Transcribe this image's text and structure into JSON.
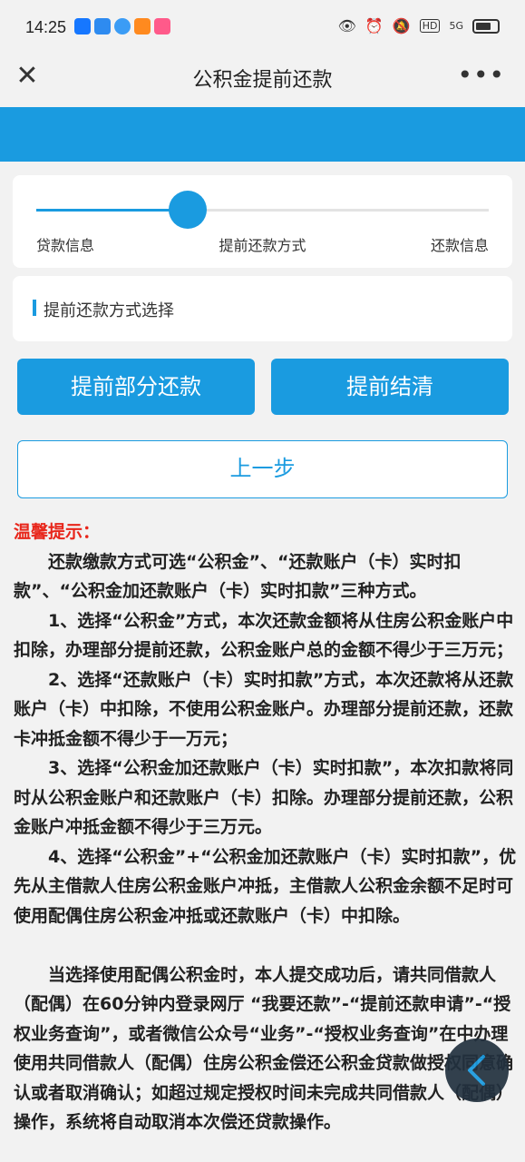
{
  "status_bar": {
    "time": "14:25",
    "signal_text": "5G",
    "hd_text": "HD"
  },
  "nav": {
    "title": "公积金提前还款"
  },
  "steps": {
    "items": [
      "贷款信息",
      "提前还款方式",
      "还款信息"
    ],
    "current_index": 1
  },
  "section": {
    "title": "提前还款方式选择"
  },
  "buttons": {
    "partial": "提前部分还款",
    "full": "提前结清",
    "prev": "上一步"
  },
  "tips": {
    "title": "温馨提示：",
    "paragraphs": [
      "还款缴款方式可选“公积金”、“还款账户（卡）实时扣款”、“公积金加还款账户（卡）实时扣款”三种方式。",
      "1、选择“公积金”方式，本次还款金额将从住房公积金账户中扣除，办理部分提前还款，公积金账户总的金额不得少于三万元；",
      "2、选择“还款账户（卡）实时扣款”方式，本次还款将从还款账户（卡）中扣除，不使用公积金账户。办理部分提前还款，还款卡冲抵金额不得少于一万元；",
      "3、选择“公积金加还款账户（卡）实时扣款”，本次扣款将同时从公积金账户和还款账户（卡）扣除。办理部分提前还款，公积金账户冲抵金额不得少于三万元。",
      "4、选择“公积金”+“公积金加还款账户（卡）实时扣款”，优先从主借款人住房公积金账户冲抵，主借款人公积金余额不足时可使用配偶住房公积金冲抵或还款账户（卡）中扣除。",
      "当选择使用配偶公积金时，本人提交成功后，请共同借款人（配偶）在60分钟内登录网厅 “我要还款”-“提前还款申请”-“授权业务查询”，或者微信公众号“业务”-“授权业务查询”在中办理使用共同借款人（配偶）住房公积金偿还公积金贷款做授权同意确认或者取消确认；如超过规定授权时间未完成共同借款人（配偶）操作，系统将自动取消本次偿还贷款操作。"
    ]
  },
  "colors": {
    "accent": "#1a9be0",
    "warning": "#e8261b",
    "background": "#f2f2f2"
  },
  "icons": {
    "close": "close-icon",
    "more": "more-icon",
    "back": "chevron-left-icon"
  }
}
